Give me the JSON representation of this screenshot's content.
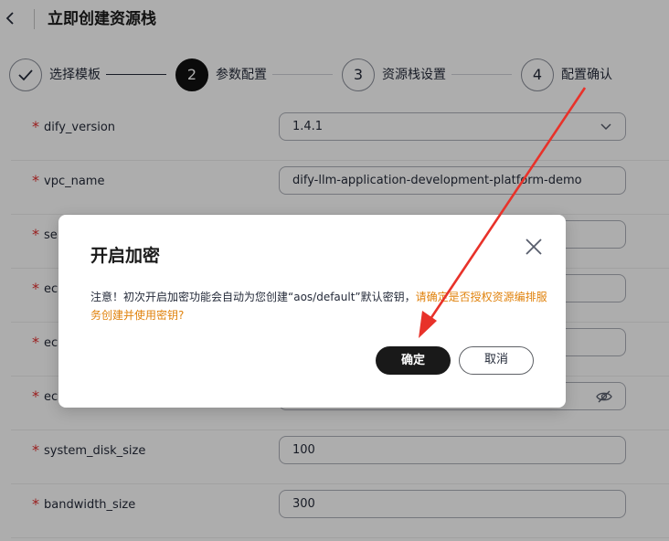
{
  "header": {
    "title": "立即创建资源栈"
  },
  "steps": [
    {
      "number": "",
      "label": "选择模板",
      "state": "done"
    },
    {
      "number": "2",
      "label": "参数配置",
      "state": "active"
    },
    {
      "number": "3",
      "label": "资源栈设置",
      "state": "pending"
    },
    {
      "number": "4",
      "label": "配置确认",
      "state": "pending"
    }
  ],
  "form": {
    "rows": [
      {
        "label": "dify_version",
        "value": "1.4.1",
        "kind": "select"
      },
      {
        "label": "vpc_name",
        "value": "dify-llm-application-development-platform-demo",
        "kind": "text"
      },
      {
        "label": "se",
        "value": "",
        "kind": "text"
      },
      {
        "label": "ec",
        "value": "",
        "kind": "text"
      },
      {
        "label": "ec",
        "value": "",
        "kind": "text"
      },
      {
        "label": "ec",
        "value": "",
        "kind": "password"
      },
      {
        "label": "system_disk_size",
        "value": "100",
        "kind": "text"
      },
      {
        "label": "bandwidth_size",
        "value": "300",
        "kind": "text"
      }
    ]
  },
  "modal": {
    "title": "开启加密",
    "message_normal": "注意！初次开启加密功能会自动为您创建“aos/default”默认密钥，",
    "message_warning": "请确定是否授权资源编排服务创建并使用密钥?",
    "confirm_label": "确定",
    "cancel_label": "取消"
  },
  "colors": {
    "accent_dark": "#191919",
    "required_star": "#e32d2d",
    "warning_text": "#e0820c",
    "annotation_arrow": "#e8322a"
  },
  "icons": [
    "back-arrow-icon",
    "checkmark-icon",
    "chevron-down-icon",
    "eye-off-icon",
    "close-icon"
  ]
}
